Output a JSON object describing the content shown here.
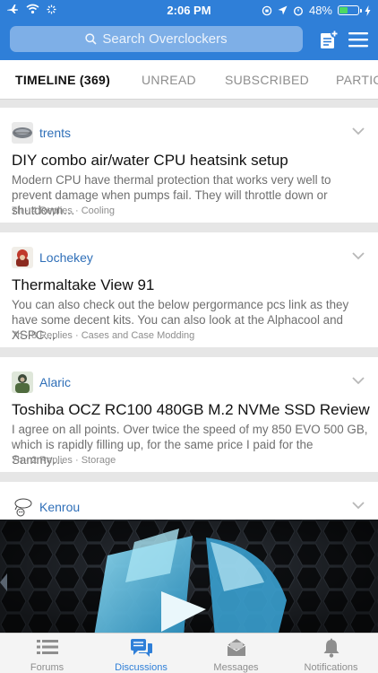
{
  "status_bar": {
    "time": "2:06 PM",
    "battery_percent": "48%",
    "battery_level": 0.48,
    "battery_color": "#4cd964"
  },
  "header": {
    "background": "#2f7fd8",
    "search_placeholder": "Search Overclockers",
    "new_thread_icon": "compose-icon",
    "menu_icon": "hamburger-menu-icon"
  },
  "tabs": [
    {
      "label": "TIMELINE (369)",
      "active": true
    },
    {
      "label": "UNREAD",
      "active": false
    },
    {
      "label": "SUBSCRIBED",
      "active": false
    },
    {
      "label": "PARTIC",
      "active": false
    }
  ],
  "threads": [
    {
      "user": "trents",
      "title": "DIY combo air/water CPU heatsink setup",
      "excerpt": "Modern CPU have thermal protection that works very well to prevent damage when pumps fail. They will throttle down or shutdown…",
      "age": "7h",
      "replies": "4 Replies",
      "forum": "Cooling"
    },
    {
      "user": "Lochekey",
      "title": "Thermaltake View 91",
      "excerpt": "You can also check out the below pergormance pcs link as they have some decent kits. You can also look at the Alphacool and XSPC…",
      "age": "7h",
      "replies": "8 Replies",
      "forum": "Cases and Case Modding"
    },
    {
      "user": "Alaric",
      "title": "Toshiba OCZ RC100 480GB M.2 NVMe SSD Review",
      "excerpt": "I agree on all points. Over twice the speed of my 850 EVO 500 GB, which is rapidly filling up, for the same price I paid for the Sammy…",
      "age": "7h",
      "replies": "2 Replies",
      "forum": "Storage"
    },
    {
      "user": "Kenrou"
    }
  ],
  "meta_separator": "·",
  "bottom_nav": [
    {
      "label": "Forums",
      "icon": "list-icon",
      "active": false
    },
    {
      "label": "Discussions",
      "icon": "chat-bubbles-icon",
      "active": true
    },
    {
      "label": "Messages",
      "icon": "envelope-icon",
      "active": false
    },
    {
      "label": "Notifications",
      "icon": "bell-icon",
      "active": false
    }
  ]
}
